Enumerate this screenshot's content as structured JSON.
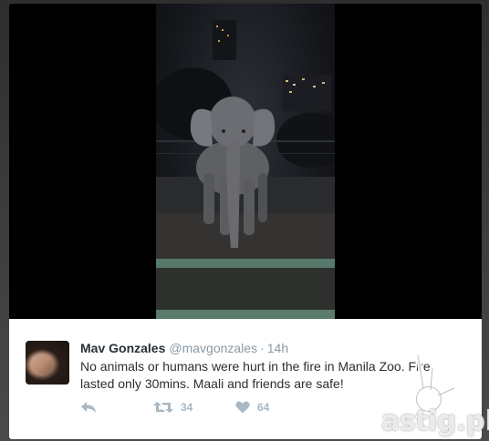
{
  "tweet": {
    "name": "Mav Gonzales",
    "handle": "@mavgonzales",
    "separator": "·",
    "time": "14h",
    "text": "No animals or humans were hurt in the fire in Manila Zoo. Fire lasted only 30mins. Maali and friends are safe!",
    "actions": {
      "reply": {
        "icon": "reply-icon"
      },
      "retweet": {
        "icon": "retweet-icon",
        "count": "34"
      },
      "like": {
        "icon": "heart-icon",
        "count": "64"
      }
    }
  },
  "watermark": {
    "text": "astig.ph",
    "icon": "astig-hand-logo"
  },
  "colors": {
    "name": "#292f33",
    "secondary": "#8899a6",
    "action": "#aab8c2",
    "backdrop": "#3a3a3a"
  }
}
